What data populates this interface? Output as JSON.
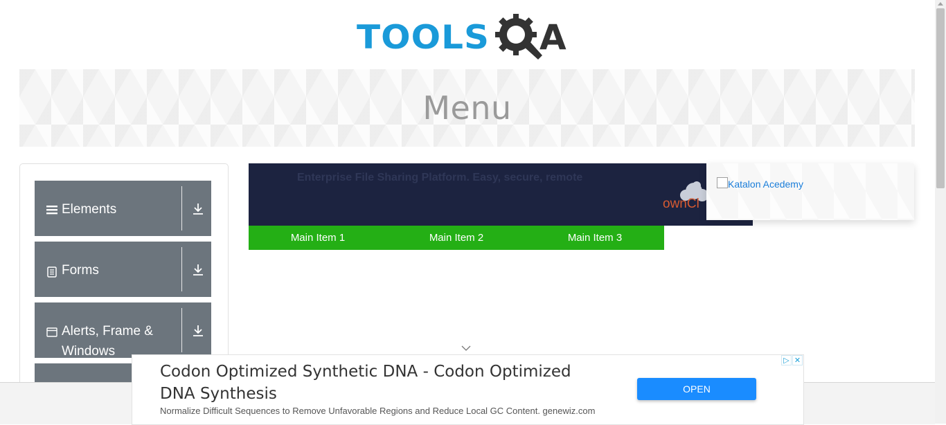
{
  "header": {
    "logo_tools": "TOOLS",
    "logo_a": "A"
  },
  "banner": {
    "title": "Menu"
  },
  "sidebar": {
    "groups": [
      {
        "label": "Elements",
        "icon": "hamburger-icon"
      },
      {
        "label": "Forms",
        "icon": "document-icon"
      },
      {
        "label": "Alerts, Frame & Windows",
        "icon": "window-icon"
      }
    ]
  },
  "ad_strip": {
    "tagline": "Enterprise File Sharing Platform. Easy, secure, remote",
    "brand": "ownCl"
  },
  "menu": {
    "items": [
      "Main Item 1",
      "Main Item 2",
      "Main Item 3"
    ]
  },
  "katalon": {
    "alt_text": "Katalon Acedemy"
  },
  "bottom_ad": {
    "headline": "Codon Optimized Synthetic DNA - Codon Optimized DNA Synthesis",
    "description": "Normalize Difficult Sequences to Remove Unfavorable Regions and Reduce Local GC Content. genewiz.com",
    "open_label": "OPEN"
  },
  "colors": {
    "accent_blue": "#1a9ad9",
    "menu_green": "#24af15",
    "sidebar_gray": "#6c757d",
    "open_button": "#1a8cff"
  }
}
